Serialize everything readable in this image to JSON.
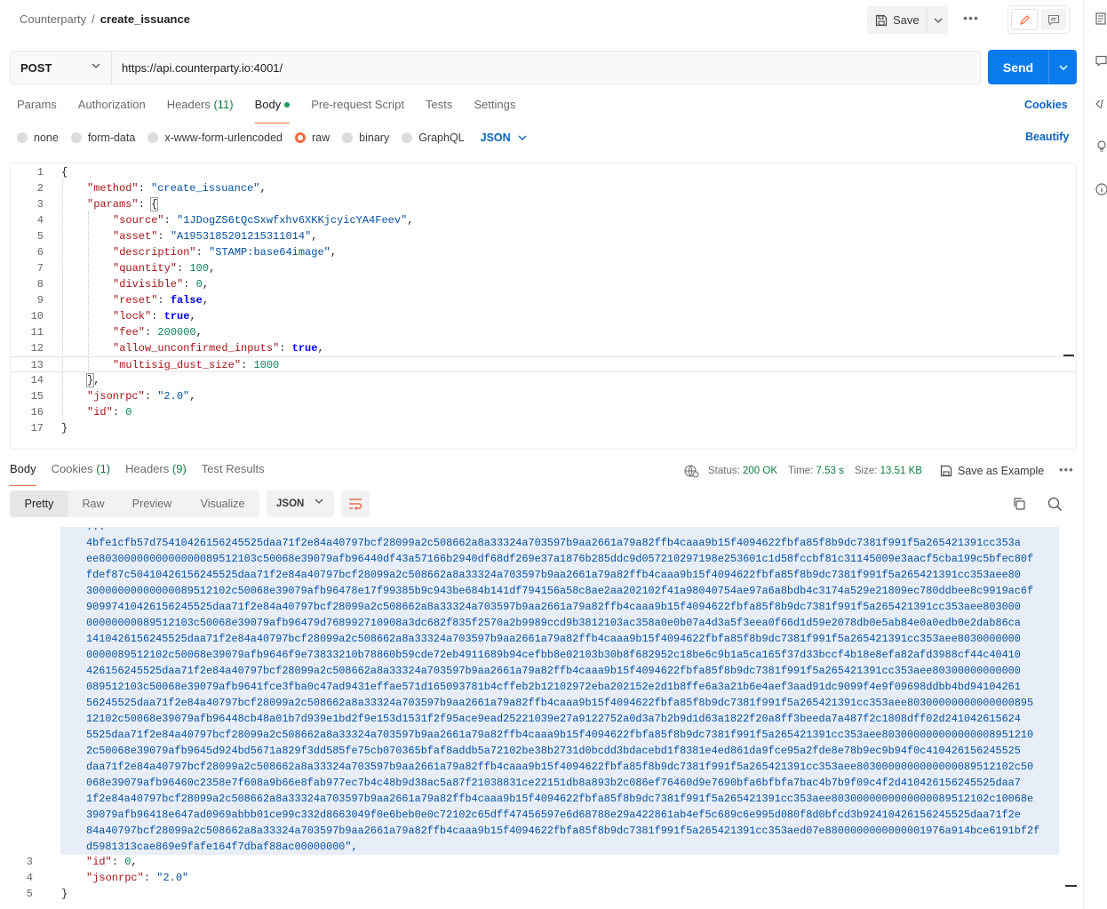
{
  "breadcrumb": {
    "collection": "Counterparty",
    "separator": "/",
    "request": "create_issuance"
  },
  "toolbar": {
    "save_label": "Save",
    "more_label": "•••"
  },
  "request": {
    "method": "POST",
    "url": "https://api.counterparty.io:4001/",
    "send_label": "Send"
  },
  "request_tabs": [
    {
      "label": "Params",
      "count": ""
    },
    {
      "label": "Authorization",
      "count": ""
    },
    {
      "label": "Headers",
      "count": "(11)"
    },
    {
      "label": "Body",
      "count": ""
    },
    {
      "label": "Pre-request Script",
      "count": ""
    },
    {
      "label": "Tests",
      "count": ""
    },
    {
      "label": "Settings",
      "count": ""
    }
  ],
  "cookies_label": "Cookies",
  "body_types": [
    "none",
    "form-data",
    "x-www-form-urlencoded",
    "raw",
    "binary",
    "GraphQL"
  ],
  "body_format": "JSON",
  "beautify_label": "Beautify",
  "request_body": {
    "line_numbers": [
      "1",
      "2",
      "3",
      "4",
      "5",
      "6",
      "7",
      "8",
      "9",
      "10",
      "11",
      "12",
      "13",
      "14",
      "15",
      "16",
      "17"
    ]
  },
  "request_values": {
    "method": "\"method\"",
    "method_val": "\"create_issuance\"",
    "params": "\"params\"",
    "source": "\"source\"",
    "source_val": "\"1JDogZS6tQcSxwfxhv6XKKjcyicYA4Feev\"",
    "asset": "\"asset\"",
    "asset_val": "\"A195318520121531101​4\"",
    "description": "\"description\"",
    "description_val": "\"STAMP:base64image\"",
    "quantity": "\"quantity\"",
    "quantity_val": "100",
    "divisible": "\"divisible\"",
    "divisible_val": "0",
    "reset": "\"reset\"",
    "reset_val": "false",
    "lock": "\"lock\"",
    "lock_val": "true",
    "fee": "\"fee\"",
    "fee_val": "200000",
    "allow_unconfirmed_inputs": "\"allow_unconfirmed_inputs\"",
    "allow_unconfirmed_inputs_val": "true",
    "multisig_dust_size": "\"multisig_dust_size\"",
    "multisig_dust_size_val": "1000",
    "jsonrpc": "\"jsonrpc\"",
    "jsonrpc_val": "\"2.0\"",
    "id": "\"id\"",
    "id_val": "0"
  },
  "response_tabs": [
    {
      "label": "Body",
      "count": ""
    },
    {
      "label": "Cookies",
      "count": "(1)"
    },
    {
      "label": "Headers",
      "count": "(9)"
    },
    {
      "label": "Test Results",
      "count": ""
    }
  ],
  "response_status": {
    "status_label": "Status:",
    "status_value": "200 OK",
    "time_label": "Time:",
    "time_value": "7.53 s",
    "size_label": "Size:",
    "size_value": "13.51 KB",
    "save_example_label": "Save as Example"
  },
  "response_views": [
    "Pretty",
    "Raw",
    "Preview",
    "Visualize"
  ],
  "response_format": "JSON",
  "response_hex_lines": [
    "...",
    "4bfe1cfb57d75410426156245525daa71f2e84a40797bcf28099a2c508662a8a33324a703597b9aa2661a79a82ffb4caaa9b15f4094622fbfa85f8b9dc7381f991f5a265421391cc353a",
    "ee8030000000000000089512103c50068e39079afb96440df43a57166b2940df68df269e37a1876b285ddc9d057210297198e253601c1d58fccbf81c31145009e3aacf5cba199c5bfec80f",
    "fdef87c50410426156245525daa71f2e84a40797bcf28099a2c508662a8a33324a703597b9aa2661a79a82ffb4caaa9b15f4094622fbfa85f8b9dc7381f991f5a265421391cc353aee80",
    "30000000000000089512102c50068e39079afb96478e17f99385b9c943be684b141df794156a58c8ae2aa202102f41a98040754ae97a6a8bdb4c3174a529e21809ec780ddbee8c9919ac6f",
    "9099741042615624552​5daa71f2e84a40797bcf28099a2c508662a8a33324a703597b9aa2661a79a82ffb4caaa9b15f4094622fbfa85f8b9dc7381f991f5a265421391cc353aee803000",
    "00000000089512103c50068e39079afb96479d768992710908a3dc682f835f2570a2b9989ccd9b3812103ac358a0e0b07a4d3a5f3eea0f66d1d59e2078db0e5ab84e0a0edb0e2dab86ca",
    "1410426156245525daa71f2e84a40797bcf28099a2c508662a8a33324a703597b9aa2661a79a82ffb4caaa9b15f4094622fbfa85f8b9dc7381f991f5a265421391cc353aee8030000000",
    "0000089512102c50068e39079afb9646f9e73833210b78860b59cde72eb4911689b94cefbb8e02103b30b8f682952c18be6c9b1a5ca165f37d33bccf4b18e8efa82afd3988cf44c40410",
    "426156245525daa71f2e84a40797bcf28099a2c508662a8a33324a703597b9aa2661a79a82ffb4caaa9b15f4094622fbfa85f8b9dc7381f991f5a265421391cc353aee80300000000000",
    "089512103c50068e39079afb9641fce3fba0c47ad9431effae571d165093781b4cffeb2b12102972eba202152e2d1b8ffe6a3a21b6e4aef3aad91dc9099f4e9f09698ddbb4bd94104261",
    "56245525daa71f2e84a40797bcf28099a2c508662a8a33324a703597b9aa2661a79a82ffb4caaa9b15f4094622fbfa85f8b9dc7381f991f5a265421391cc353aee80300000000000000895",
    "12102c50068e39079afb96448cb48a01b7d939e1bd2f9e153d1531f2f95ace9ead25221039e27a9122752a0d3a7b2b9d1d63a1822f20a8ff3beeda7a487f2c1808dff02d241042615624",
    "5525daa71f2e84a40797bcf28099a2c508662a8a33324a703597b9aa2661a79a82ffb4caaa9b15f4094622fbfa85f8b9dc7381f991f5a265421391cc353aee8030000000000000089512​10",
    "2c50068e39079afb9645d924bd5671a829f3dd585fe75cb070365bfaf8addb5a72102be38b2731d0bcdd3bdacebd1f8381e4ed861da9fce95a2fde8e78b9ec9b94f0c410426156245525",
    "daa71f2e84a40797bcf28099a2c508662a8a33324a703597b9aa2661a79a82ffb4caaa9b15f4094622fbfa85f8b9dc7381f991f5a265421391cc353aee80300000000000000895121​02c50",
    "068e39079afb96460c2358e7f608a9b66e8fab977ec7b4c48b9d38ac5a87f21038831ce22151db8a893b2c086ef76460d9e7690bfa6bfbfa7bac4b7b9f09c4f2d4104261562455​25daa7",
    "1f2e84a40797bcf28099a2c508662a8a33324a703597b9aa2661a79a82ffb4caaa9b15f4094622fbfa85f8b9dc7381f991f5a265421391cc353aee80300000000000000895121​02c10068e",
    "39079afb96418e647ad0969abbb01ce99c332d8663049f0e6beb0e0c72102c65dff47456597e6d68788e29a422861ab4ef5c689c6e995d080f8d0bfcd3b924104261562455​25daa71f2e",
    "84a40797bcf28099a2c508662a8a33324a703597b9aa2661a79a82ffb4caaa9b15f4094622fbfa85f8b9dc7381f991f5a265421391cc353aed07e8800000000000001976a914bce6191bf2f",
    "d5981313cae869e9fafe164f7dbaf88ac00000000\","
  ],
  "response_tail": {
    "line3": "3",
    "id_key": "\"id\"",
    "id_val": "0",
    "line4": "4",
    "jsonrpc_key": "\"jsonrpc\"",
    "jsonrpc_val": "\"2.0\"",
    "line5": "5"
  }
}
